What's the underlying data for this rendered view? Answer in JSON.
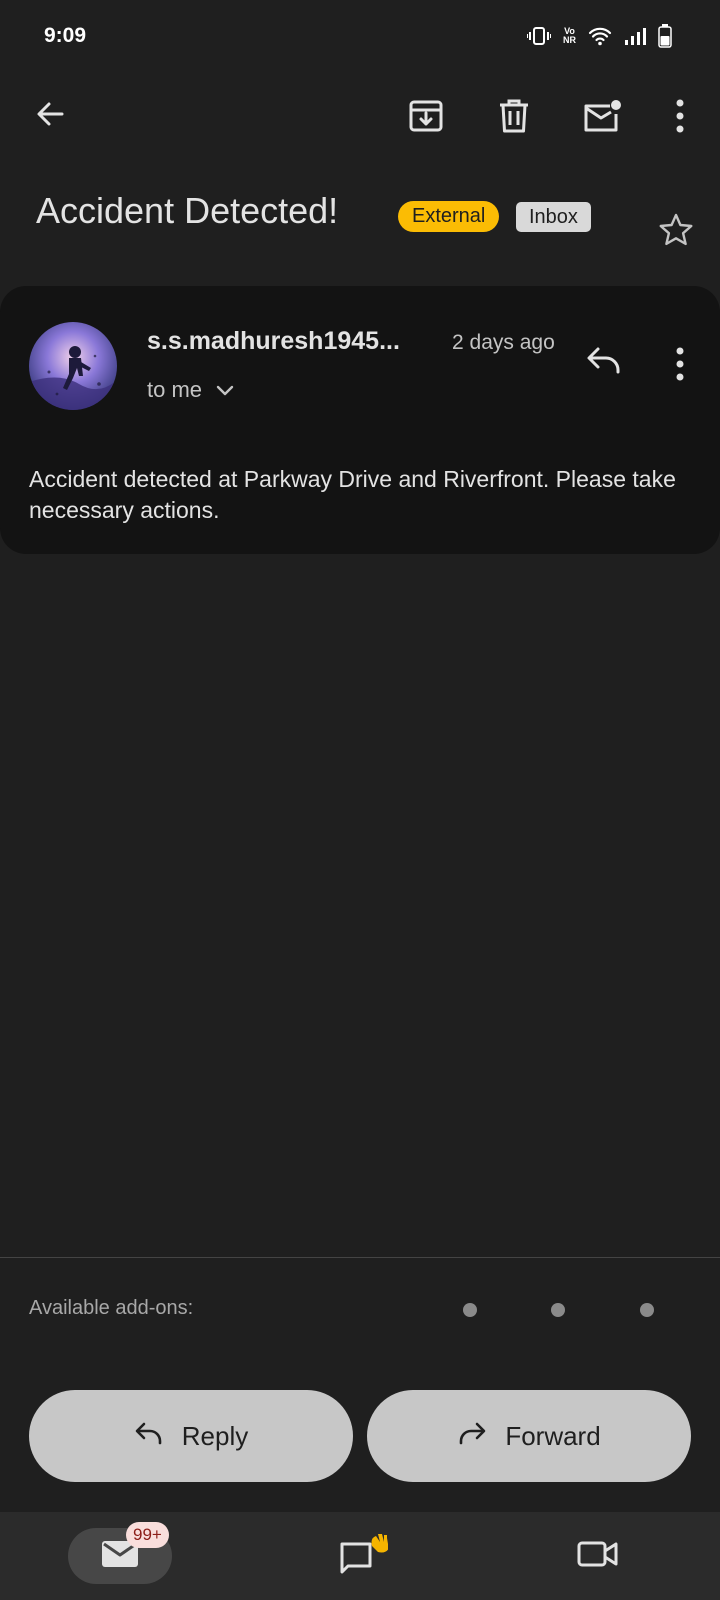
{
  "status_bar": {
    "time": "9:09",
    "icons": [
      "vibrate-icon",
      "volte-icon",
      "wifi-icon",
      "signal-icon",
      "battery-icon"
    ],
    "volte_top": "Vo",
    "volte_bottom": "NR"
  },
  "toolbar": {
    "icons": [
      "back-arrow-icon",
      "archive-icon",
      "delete-icon",
      "mark-unread-icon",
      "more-vert-icon"
    ]
  },
  "email": {
    "subject": "Accident Detected!",
    "labels": {
      "external": "External",
      "inbox": "Inbox"
    },
    "sender": "s.s.madhuresh1945...",
    "time": "2 days ago",
    "recipient": "to me",
    "body": "Accident detected at Parkway Drive and Riverfront. Please take necessary actions."
  },
  "addons": {
    "label": "Available add-ons:"
  },
  "actions": {
    "reply": "Reply",
    "forward": "Forward"
  },
  "bottom_nav": {
    "mail_badge": "99+",
    "items": [
      "mail-icon",
      "chat-icon",
      "meet-icon"
    ]
  },
  "colors": {
    "background": "#1f1f1f",
    "card": "#131313",
    "external_badge": "#fbbc04",
    "inbox_badge": "#d9d9d9",
    "pill": "#c7c7c7"
  }
}
